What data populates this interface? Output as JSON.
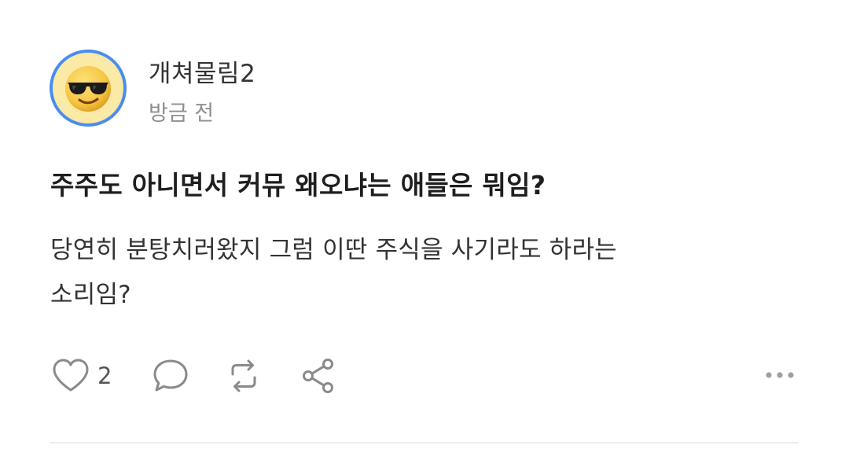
{
  "post": {
    "author": "개쳐물림2",
    "time": "방금 전",
    "title": "주주도 아니면서 커뮤 왜오냐는 애들은 뭐임?",
    "body_lines": [
      "당연히 분탕치러왔지 그럼 이딴 주식을 사기라도 하라는",
      "소리임?"
    ],
    "avatar_icon": "sunglasses-emoji-icon",
    "avatar_border_color": "#4a8df0",
    "avatar_bg_color": "#fbe9a6"
  },
  "actions": {
    "like_count": "2",
    "like_icon": "heart-icon",
    "comment_icon": "comment-bubble-icon",
    "repost_icon": "repost-icon",
    "share_icon": "share-icon",
    "more_icon": "more-dots-icon"
  }
}
